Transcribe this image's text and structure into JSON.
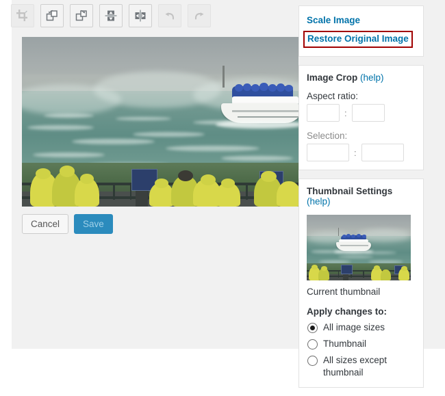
{
  "toolbar": {
    "buttons": [
      {
        "name": "crop",
        "label": "Crop",
        "icon": "crop-icon",
        "disabled": true
      },
      {
        "name": "rotate-left",
        "label": "Rotate counter-clockwise",
        "icon": "rotate-left-icon",
        "disabled": false
      },
      {
        "name": "rotate-right",
        "label": "Rotate clockwise",
        "icon": "rotate-right-icon",
        "disabled": false
      },
      {
        "name": "flip-vertical",
        "label": "Flip vertically",
        "icon": "flip-vertical-icon",
        "disabled": false
      },
      {
        "name": "flip-horizontal",
        "label": "Flip horizontally",
        "icon": "flip-horizontal-icon",
        "disabled": false
      },
      {
        "name": "undo",
        "label": "Undo",
        "icon": "undo-icon",
        "disabled": true
      },
      {
        "name": "redo",
        "label": "Redo",
        "icon": "redo-icon",
        "disabled": true
      }
    ]
  },
  "editor": {
    "image_alt": "Maid of the Mist tour boat with passengers in blue ponchos on the Niagara River, viewers in yellow ponchos at the railing in the foreground",
    "cancel_label": "Cancel",
    "save_label": "Save"
  },
  "sidebar": {
    "scale_panel": {
      "scale_image_label": "Scale Image",
      "restore_label": "Restore Original Image",
      "restore_highlight_color": "#a00000"
    },
    "crop_panel": {
      "title": "Image Crop",
      "help_label": "(help)",
      "aspect_ratio_label": "Aspect ratio:",
      "aspect_ratio_separator": ":",
      "aspect_ratio_width": "",
      "aspect_ratio_height": "",
      "selection_label": "Selection:",
      "selection_separator": ":",
      "selection_width": "",
      "selection_height": ""
    },
    "thumbnail_panel": {
      "title": "Thumbnail Settings",
      "help_label": "(help)",
      "thumbnail_caption": "Current thumbnail",
      "thumbnail_alt": "Thumbnail preview of the Maid of the Mist boat at Niagara Falls",
      "apply_title": "Apply changes to:",
      "options": [
        {
          "label": "All image sizes",
          "selected": true
        },
        {
          "label": "Thumbnail",
          "selected": false
        },
        {
          "label": "All sizes except thumbnail",
          "selected": false
        }
      ]
    }
  },
  "colors": {
    "link": "#0073aa",
    "primary_button": "#2b8bbd",
    "panel_border": "#e2e2e2",
    "workspace": "#f1f1f1",
    "highlight": "#a00000"
  }
}
